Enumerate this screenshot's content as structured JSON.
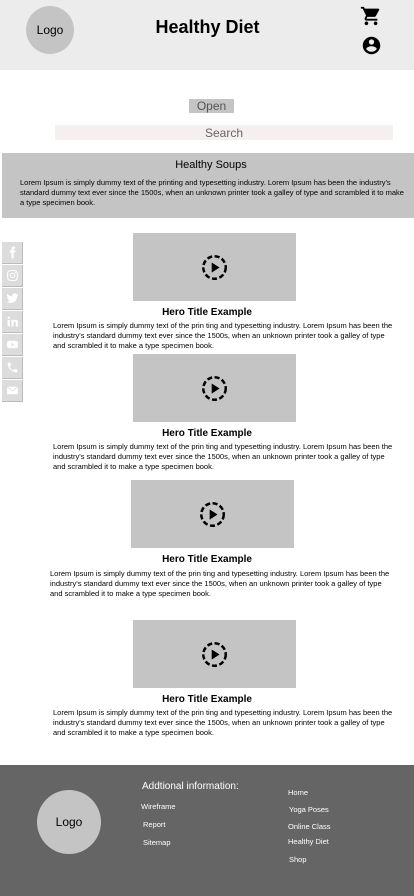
{
  "header": {
    "logo_label": "Logo",
    "title": "Healthy Diet",
    "cart_icon": "shopping-cart-icon",
    "account_icon": "account-circle-icon"
  },
  "controls": {
    "open_label": "Open",
    "search_placeholder": "Search"
  },
  "banner": {
    "title": "Healthy Soups",
    "text": "Lorem Ipsum is simply dummy text of the printing and typesetting industry. Lorem Ipsum has been the industry's standard dummy text ever since the 1500s, when an unknown printer took a galley of type and scrambled it to make a type specimen book."
  },
  "social": [
    "facebook-icon",
    "instagram-icon",
    "twitter-icon",
    "linkedin-icon",
    "youtube-icon",
    "phone-icon",
    "mail-icon"
  ],
  "heroes": [
    {
      "title": "Hero Title Example",
      "text": "Lorem Ipsum is simply dummy text of the prin ting and typesetting industry. Lorem Ipsum has been the industry's standard dummy text ever since the 1500s, when an unknown printer took a galley of type and scrambled it to make a type specimen book."
    },
    {
      "title": "Hero Title Example",
      "text": "Lorem Ipsum is simply dummy text of the prin ting and typesetting industry. Lorem Ipsum has been the industry's standard dummy text ever since the 1500s, when an unknown printer took a galley of type and scrambled it to make a type specimen book."
    },
    {
      "title": "Hero Title Example",
      "text": "Lorem Ipsum is simply dummy text of the prin ting and typesetting industry. Lorem Ipsum has been the industry's standard dummy text ever since the 1500s, when an unknown printer took a galley of type and scrambled it to make a type specimen book."
    },
    {
      "title": "Hero Title Example",
      "text": "Lorem Ipsum is simply dummy text of the prin ting and typesetting industry. Lorem Ipsum has been the industry's standard dummy text ever since the 1500s, when an unknown printer took a galley of type and scrambled it to make a type specimen book."
    }
  ],
  "footer": {
    "logo_label": "Logo",
    "heading": "Addtional information:",
    "left_links": [
      "Wireframe",
      "Report",
      "Sitemap"
    ],
    "right_links": [
      "Home",
      "Yoga Poses",
      "Online Class",
      "Healthy Diet",
      "Shop"
    ]
  }
}
